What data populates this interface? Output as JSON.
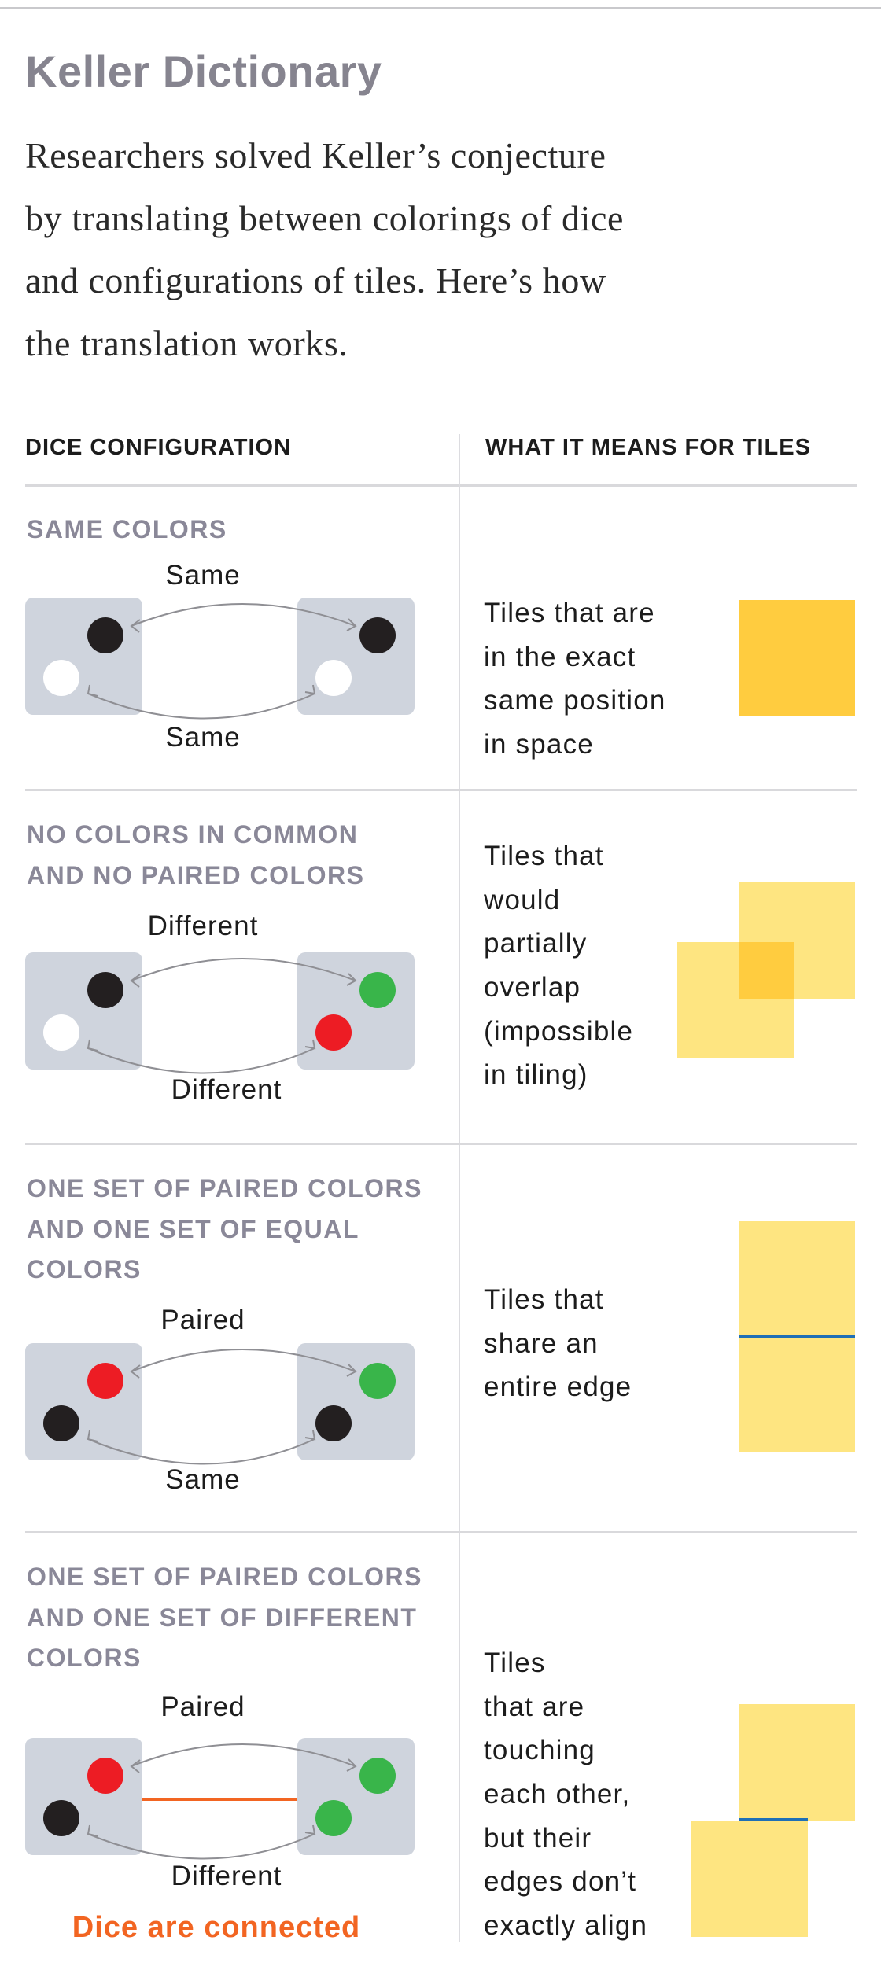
{
  "title": "Keller Dictionary",
  "intro_lines": [
    "Researchers solved Keller’s conjecture",
    "by translating between colorings of dice",
    "and configurations of tiles. Here’s how",
    "the translation works."
  ],
  "table": {
    "headers": [
      "DICE CONFIGURATION",
      "WHAT IT MEANS FOR TILES"
    ],
    "rows": [
      {
        "label_lines": [
          "SAME COLORS"
        ],
        "top_caption": "Same",
        "bottom_caption": "Same",
        "left_die": {
          "top_dot": "black",
          "bottom_dot": "white"
        },
        "right_die": {
          "top_dot": "black",
          "bottom_dot": "white"
        },
        "connected": false,
        "description_lines": [
          "Tiles that are",
          "in the exact",
          "same position",
          "in space"
        ],
        "tiles": "same-position"
      },
      {
        "label_lines": [
          "NO COLORS IN COMMON",
          "AND NO PAIRED COLORS"
        ],
        "top_caption": "Different",
        "bottom_caption": "Different",
        "left_die": {
          "top_dot": "black",
          "bottom_dot": "white"
        },
        "right_die": {
          "top_dot": "green",
          "bottom_dot": "red"
        },
        "connected": false,
        "description_lines": [
          "Tiles that",
          "would",
          "partially",
          "overlap",
          "(impossible",
          "in tiling)"
        ],
        "tiles": "overlap"
      },
      {
        "label_lines": [
          "ONE SET OF PAIRED COLORS",
          "AND ONE SET OF EQUAL",
          "COLORS"
        ],
        "top_caption": "Paired",
        "bottom_caption": "Same",
        "left_die": {
          "top_dot": "red",
          "bottom_dot": "black"
        },
        "right_die": {
          "top_dot": "green",
          "bottom_dot": "black"
        },
        "connected": false,
        "description_lines": [
          "Tiles that",
          "share an",
          "entire edge"
        ],
        "tiles": "shared-edge"
      },
      {
        "label_lines": [
          "ONE SET OF PAIRED COLORS",
          "AND ONE SET OF DIFFERENT",
          "COLORS"
        ],
        "top_caption": "Paired",
        "bottom_caption": "Different",
        "left_die": {
          "top_dot": "red",
          "bottom_dot": "black"
        },
        "right_die": {
          "top_dot": "green",
          "bottom_dot": "green"
        },
        "connected": true,
        "connected_note": "Dice are connected",
        "description_lines": [
          "Tiles",
          "that are",
          "touching",
          "each other,",
          "but their",
          "edges don’t",
          "exactly align"
        ],
        "tiles": "offset-touch"
      }
    ]
  },
  "colors": {
    "title": "#86848f",
    "label": "#8a8898",
    "die": "#cfd4dd",
    "black": "#231f20",
    "white": "#ffffff",
    "red": "#ed1c24",
    "green": "#39b54a",
    "tile_solid": "#ffcc3f",
    "tile_light": "#fee581",
    "edge": "#1f6fb6",
    "connector": "#f26522",
    "arrow": "#8f8f94"
  }
}
